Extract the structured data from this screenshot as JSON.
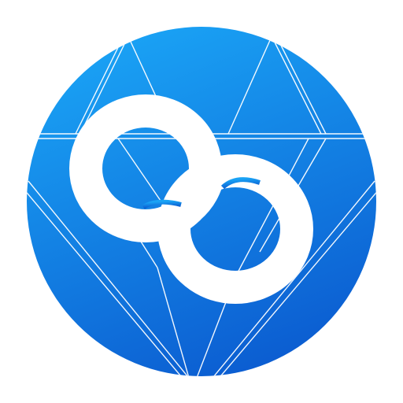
{
  "logo": {
    "name": "blue-circle-linked-rings-logo",
    "colors": {
      "gradient_top": "#1aa3f5",
      "gradient_bottom": "#0b5bd0",
      "facet_lines": "#ffffff",
      "rings": "#ffffff"
    }
  }
}
